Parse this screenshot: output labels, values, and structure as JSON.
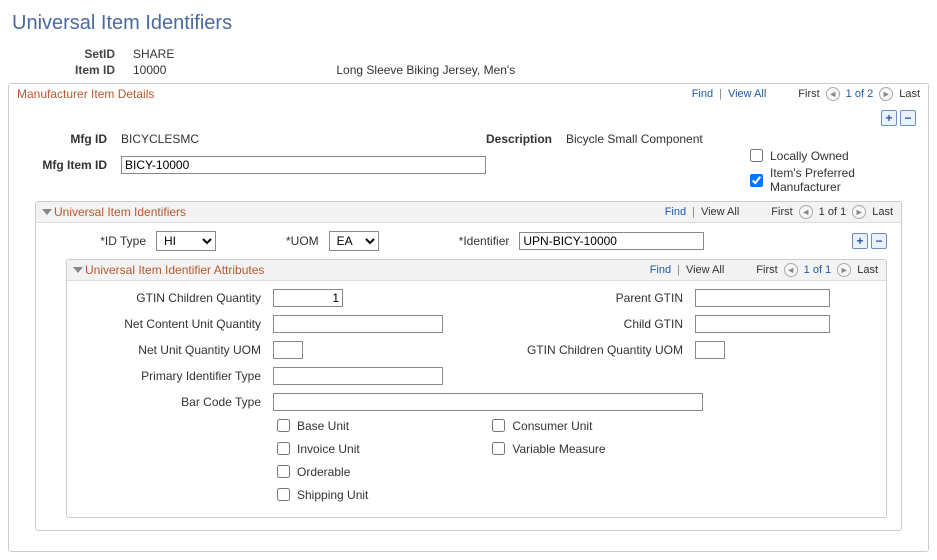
{
  "pageTitle": "Universal Item Identifiers",
  "header": {
    "setid_label": "SetID",
    "setid_value": "SHARE",
    "itemid_label": "Item ID",
    "itemid_value": "10000",
    "item_desc": "Long Sleeve Biking Jersey, Men's"
  },
  "mfg_section": {
    "title": "Manufacturer Item Details",
    "nav": {
      "find": "Find",
      "viewall": "View All",
      "first": "First",
      "count": "1 of 2",
      "last": "Last"
    },
    "mfgid_label": "Mfg ID",
    "mfgid_value": "BICYCLESMC",
    "desc_label": "Description",
    "desc_value": "Bicycle Small Component",
    "mfg_item_id_label": "Mfg Item ID",
    "mfg_item_id_value": "BICY-10000",
    "locally_owned_label": "Locally Owned",
    "locally_owned_checked": false,
    "preferred_mfg_label": "Item's Preferred Manufacturer",
    "preferred_mfg_checked": true
  },
  "uii_section": {
    "title": "Universal Item Identifiers",
    "nav": {
      "find": "Find",
      "viewall": "View All",
      "first": "First",
      "count": "1 of 1",
      "last": "Last"
    },
    "idtype_label": "*ID Type",
    "idtype_value": "HI",
    "uom_label": "*UOM",
    "uom_value": "EA",
    "identifier_label": "*Identifier",
    "identifier_value": "UPN-BICY-10000"
  },
  "attr_section": {
    "title": "Universal Item Identifier Attributes",
    "nav": {
      "find": "Find",
      "viewall": "View All",
      "first": "First",
      "count": "1 of 1",
      "last": "Last"
    },
    "gtin_children_qty_label": "GTIN Children Quantity",
    "gtin_children_qty_value": "1",
    "parent_gtin_label": "Parent GTIN",
    "parent_gtin_value": "",
    "net_content_unit_qty_label": "Net Content Unit Quantity",
    "net_content_unit_qty_value": "",
    "child_gtin_label": "Child GTIN",
    "child_gtin_value": "",
    "net_unit_qty_uom_label": "Net Unit Quantity UOM",
    "net_unit_qty_uom_value": "",
    "gtin_children_qty_uom_label": "GTIN Children Quantity UOM",
    "gtin_children_qty_uom_value": "",
    "primary_id_type_label": "Primary Identifier Type",
    "primary_id_type_value": "",
    "barcode_type_label": "Bar Code Type",
    "barcode_type_value": "",
    "checkboxes_left": [
      {
        "label": "Base Unit",
        "checked": false
      },
      {
        "label": "Invoice Unit",
        "checked": false
      },
      {
        "label": "Orderable",
        "checked": false
      },
      {
        "label": "Shipping Unit",
        "checked": false
      }
    ],
    "checkboxes_right": [
      {
        "label": "Consumer Unit",
        "checked": false
      },
      {
        "label": "Variable Measure",
        "checked": false
      }
    ]
  }
}
